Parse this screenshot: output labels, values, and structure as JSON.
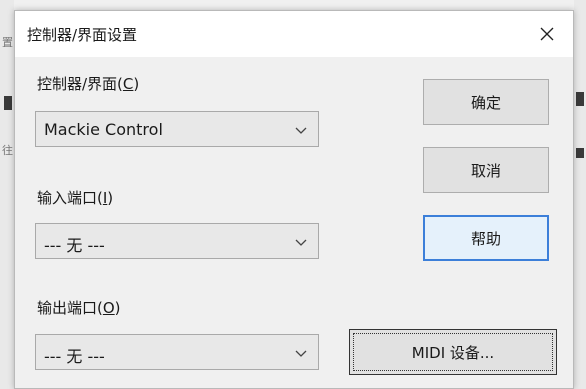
{
  "dialog": {
    "title": "控制器/界面设置",
    "close_symbol": "✕"
  },
  "fields": {
    "controller": {
      "label": "控制器/界面(",
      "key": "C",
      "suffix": ")",
      "value": "Mackie Control"
    },
    "input_port": {
      "label": "输入端口(",
      "key": "I",
      "suffix": ")",
      "value": "--- 无 ---"
    },
    "output_port": {
      "label": "输出端口(",
      "key": "O",
      "suffix": ")",
      "value": "--- 无 ---"
    }
  },
  "buttons": {
    "ok": "确定",
    "cancel": "取消",
    "help": "帮助",
    "midi": "MIDI 设备..."
  },
  "colors": {
    "focus_border": "#3c7fd9",
    "button_face": "#e1e1e1",
    "title_bg": "#ffffff"
  }
}
